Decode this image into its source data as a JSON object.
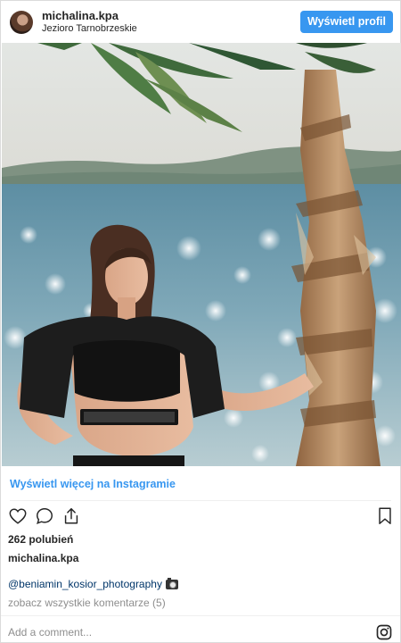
{
  "header": {
    "username": "michalina.kpa",
    "location": "Jezioro Tarnobrzeskie",
    "profile_button": "Wyświetl profil"
  },
  "photo": {
    "subject": "woman-by-palm-tree",
    "icon": "post-photo"
  },
  "view_more_link": "Wyświetl więcej na Instagramie",
  "actions": {
    "like_icon": "heart-icon",
    "comment_icon": "comment-icon",
    "share_icon": "share-icon",
    "save_icon": "bookmark-icon"
  },
  "likes": "262 polubień",
  "owner": "michalina.kpa",
  "caption": "@beniamin_kosior_photography",
  "all_comments": "zobacz wszystkie komentarze (5)",
  "comment_placeholder": "Add a comment...",
  "colors": {
    "accent": "#3897f0",
    "text": "#262626",
    "muted": "#8e8e8e",
    "link_dark": "#003569"
  }
}
